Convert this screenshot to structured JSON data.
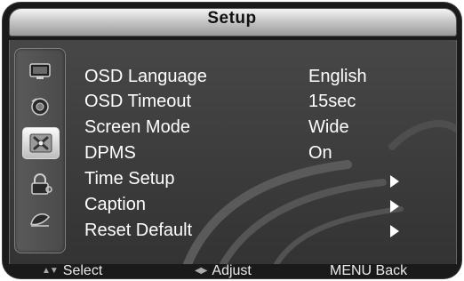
{
  "header": {
    "title": "Setup"
  },
  "sidebar": {
    "icons": [
      {
        "name": "picture-icon"
      },
      {
        "name": "sound-icon"
      },
      {
        "name": "setup-icon",
        "active": true
      },
      {
        "name": "lock-icon"
      },
      {
        "name": "channel-icon"
      }
    ]
  },
  "menu": {
    "items": [
      {
        "label": "OSD  Language",
        "value": "English"
      },
      {
        "label": "OSD Timeout",
        "value": "15sec"
      },
      {
        "label": "Screen  Mode",
        "value": "Wide"
      },
      {
        "label": "DPMS",
        "value": "On"
      },
      {
        "label": "Time Setup",
        "value": ""
      },
      {
        "label": "Caption",
        "value": ""
      },
      {
        "label": "Reset Default",
        "value": ""
      }
    ]
  },
  "footer": {
    "select_label": "Select",
    "adjust_label": "Adjust",
    "back_label": "MENU  Back"
  },
  "colors": {
    "text": "#ffffff",
    "panel": "#404040",
    "header": "#c8c8c8"
  }
}
